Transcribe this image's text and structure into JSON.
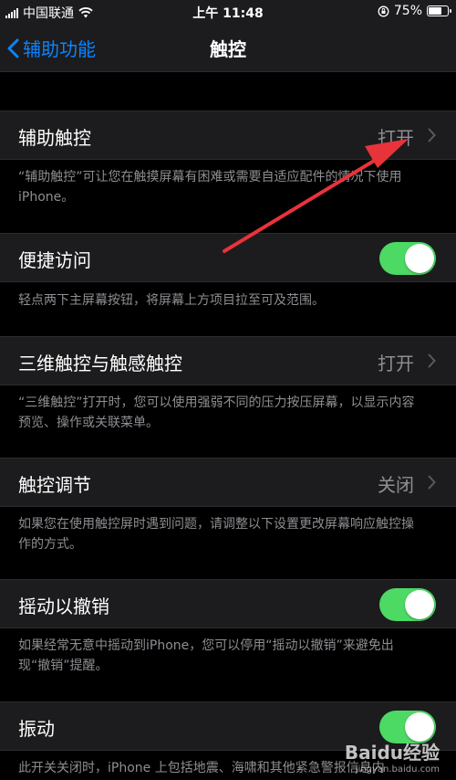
{
  "status_bar": {
    "carrier": "中国联通",
    "time": "上午 11:48",
    "battery_percent": "75%",
    "battery_level": 0.75
  },
  "nav": {
    "back_label": "辅助功能",
    "title": "触控"
  },
  "rows": [
    {
      "label": "辅助触控",
      "detail": "打开",
      "type": "disclosure"
    },
    {
      "label": "便捷访问",
      "type": "toggle",
      "on": true
    },
    {
      "label": "三维触控与触感触控",
      "detail": "打开",
      "type": "disclosure"
    },
    {
      "label": "触控调节",
      "detail": "关闭",
      "type": "disclosure"
    },
    {
      "label": "摇动以撤销",
      "type": "toggle",
      "on": true
    },
    {
      "label": "振动",
      "type": "toggle",
      "on": true
    }
  ],
  "footers": [
    "“辅助触控”可让您在触摸屏幕有困难或需要自适应配件的情况下使用 iPhone。",
    "轻点两下主屏幕按钮，将屏幕上方项目拉至可及范围。",
    "“三维触控”打开时，您可以使用强弱不同的压力按压屏幕，以显示内容预览、操作或关联菜单。",
    "如果您在使用触控屏时遇到问题，请调整以下设置更改屏幕响应触控操作的方式。",
    "如果经常无意中摇动到iPhone，您可以停用“摇动以撤销”来避免出现“撤销”提醒。",
    "此开关关闭时，iPhone 上包括地震、海啸和其他紧急警报信息内"
  ],
  "watermark": {
    "main": "Baidu经验",
    "sub": "jingyan.baidu.com"
  },
  "colors": {
    "accent": "#0a84ff",
    "toggle_on": "#4cd964",
    "arrow": "#e8333a"
  }
}
